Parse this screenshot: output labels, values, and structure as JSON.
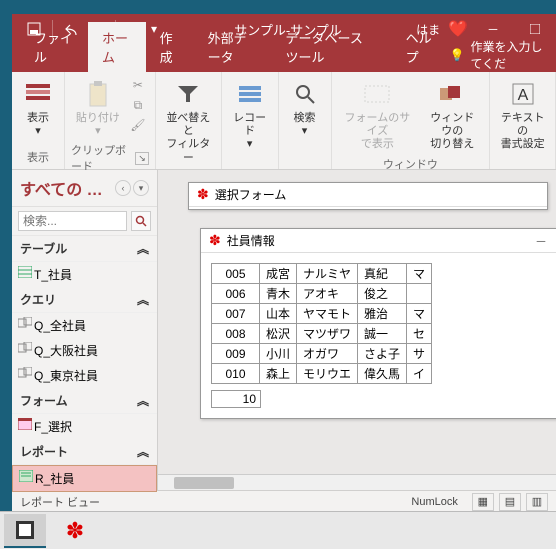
{
  "titlebar": {
    "app_title": "サンプル-サンプル",
    "user": "はま"
  },
  "tabs": {
    "file": "ファイル",
    "home": "ホーム",
    "create": "作成",
    "external": "外部データ",
    "dbtools": "データベース ツール",
    "help": "ヘルプ",
    "tellme": "作業を入力してくだ"
  },
  "ribbon": {
    "view": "表示",
    "view_grp": "表示",
    "paste": "貼り付け",
    "clipboard": "クリップボード",
    "sortfilter": "並べ替えと\nフィルター",
    "records": "レコード",
    "find": "検索",
    "formsize": "フォームのサイズ\nで表示",
    "winswitch": "ウィンドウの\n切り替え",
    "window": "ウィンドウ",
    "textfmt": "テキストの\n書式設定"
  },
  "nav": {
    "title": "すべての …",
    "search_ph": "検索...",
    "grp_table": "テーブル",
    "grp_query": "クエリ",
    "grp_form": "フォーム",
    "grp_report": "レポート",
    "t_emp": "T_社員",
    "q_all": "Q_全社員",
    "q_osaka": "Q_大阪社員",
    "q_tokyo": "Q_東京社員",
    "f_select": "F_選択",
    "r_emp": "R_社員"
  },
  "win_select": {
    "title": "選択フォーム"
  },
  "win_report": {
    "title": "社員情報",
    "rows": [
      {
        "id": "005",
        "a": "成宮",
        "b": "ナルミヤ",
        "c": "真紀",
        "d": "マ"
      },
      {
        "id": "006",
        "a": "青木",
        "b": "アオキ",
        "c": "俊之",
        "d": " "
      },
      {
        "id": "007",
        "a": "山本",
        "b": "ヤマモト",
        "c": "雅治",
        "d": "マ"
      },
      {
        "id": "008",
        "a": "松沢",
        "b": "マツザワ",
        "c": "誠一",
        "d": "セ"
      },
      {
        "id": "009",
        "a": "小川",
        "b": "オガワ",
        "c": "さよ子",
        "d": "サ"
      },
      {
        "id": "010",
        "a": "森上",
        "b": "モリウエ",
        "c": "偉久馬",
        "d": "イ"
      }
    ],
    "page": "10"
  },
  "status": {
    "view": "レポート ビュー",
    "numlock": "NumLock"
  }
}
